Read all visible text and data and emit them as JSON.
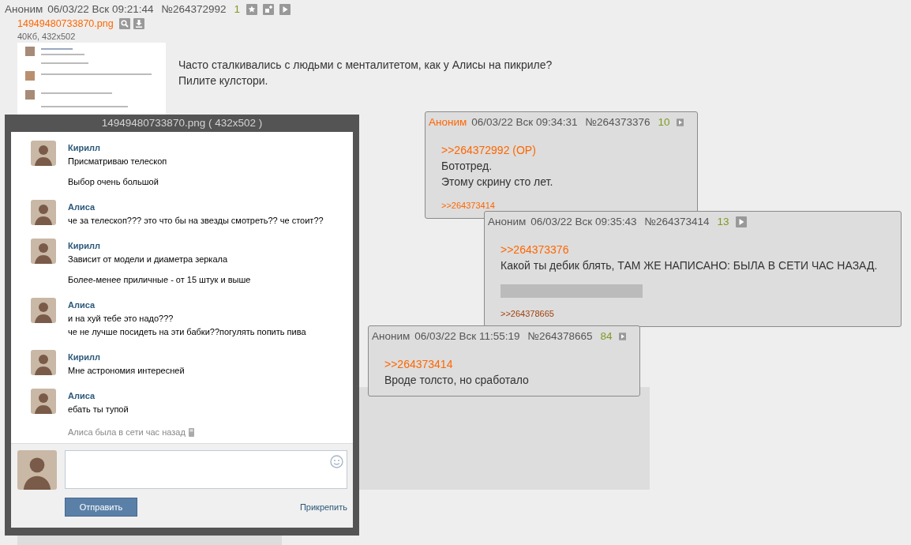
{
  "op_post": {
    "author": "Аноним",
    "date": "06/03/22 Вск 09:21:44",
    "number": "№264372992",
    "reply_count": "1",
    "file": {
      "name": "14949480733870.png",
      "info": "40Кб, 432x502"
    },
    "text": [
      "Часто сталкивались с людьми с менталитетом, как у Алисы на пикриле?",
      "Пилите кулстори."
    ]
  },
  "reply_popups": [
    {
      "author": "Аноним",
      "author_highlighted": true,
      "date": "06/03/22 Вск 09:34:31",
      "number": "№264373376",
      "reply_count": "10",
      "quote": ">>264372992 (OP)",
      "lines": [
        {
          "kind": "text",
          "text": "Бототред."
        },
        {
          "kind": "text",
          "text": "Этому скрину сто лет."
        }
      ],
      "replies": [
        {
          "text": ">>264373414",
          "visited": false
        }
      ]
    },
    {
      "author": "Аноним",
      "author_highlighted": false,
      "date": "06/03/22 Вск 09:35:43",
      "number": "№264373414",
      "reply_count": "13",
      "quote": ">>264373376",
      "lines": [
        {
          "kind": "text",
          "text": "Какой ты дебик блять, ТАМ ЖЕ НАПИСАНО: БЫЛА В СЕТИ ЧАС НАЗАД."
        },
        {
          "kind": "spoiler"
        }
      ],
      "replies": [
        {
          "text": ">>264378665",
          "visited": true
        }
      ]
    },
    {
      "author": "Аноним",
      "author_highlighted": false,
      "date": "06/03/22 Вск 11:55:19",
      "number": "№264378665",
      "reply_count": "84",
      "quote": ">>264373414",
      "lines": [
        {
          "kind": "text",
          "text": "Вроде толсто, но сработало"
        }
      ]
    }
  ],
  "image_viewer": {
    "title": "14949480733870.png ( 432x502 )",
    "messages": [
      {
        "sender": "Кирилл",
        "paragraphs": [
          [
            "Присматриваю телескоп"
          ],
          [
            "Выбор очень большой"
          ]
        ]
      },
      {
        "sender": "Алиса",
        "paragraphs": [
          [
            "че за телескоп??? это что бы на звезды смотреть?? че стоит??"
          ]
        ]
      },
      {
        "sender": "Кирилл",
        "paragraphs": [
          [
            "Зависит от модели и диаметра зеркала"
          ],
          [
            "Более-менее приличные - от 15 штук и выше"
          ]
        ]
      },
      {
        "sender": "Алиса",
        "paragraphs": [
          [
            "и на хуй тебе это надо???",
            "че не лучше посидеть на эти бабки??погулять попить пива"
          ]
        ]
      },
      {
        "sender": "Кирилл",
        "paragraphs": [
          [
            "Мне астрономия интересней"
          ]
        ]
      },
      {
        "sender": "Алиса",
        "paragraphs": [
          [
            "ебать ты тупой"
          ]
        ]
      }
    ],
    "status": "Алиса была в сети час назад",
    "send_button": "Отправить",
    "attach_link": "Прикрепить"
  }
}
